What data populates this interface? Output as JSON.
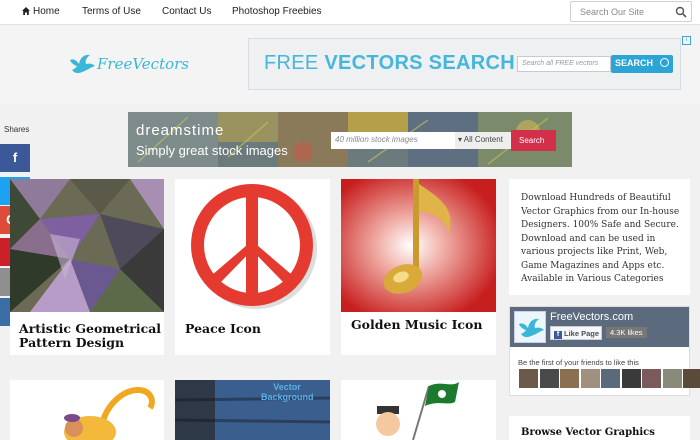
{
  "nav": {
    "home": "Home",
    "terms": "Terms of Use",
    "contact": "Contact Us",
    "freebies": "Photoshop Freebies",
    "search_placeholder": "Search Our Site"
  },
  "logo": {
    "text": "FreeVectors"
  },
  "ad_top": {
    "title_light": "FREE ",
    "title_bold": "VECTORS SEARCH",
    "input_placeholder": "Search all FREE vectors",
    "button": "SEARCH",
    "adchoice": "i"
  },
  "ad_dreamstime": {
    "brand": "dreamstime",
    "tagline": "Simply great stock images",
    "input_placeholder": "40 million stock images",
    "select": "All Content",
    "button": "Search"
  },
  "shares": {
    "label": "Shares",
    "buttons": [
      {
        "icon": "facebook-icon",
        "glyph": "f",
        "color": "#3b5998"
      },
      {
        "icon": "twitter-icon",
        "glyph": "t",
        "color": "#1da1f2"
      },
      {
        "icon": "google-plus-icon",
        "glyph": "G+",
        "color": "#dd4b39"
      },
      {
        "icon": "pinterest-icon",
        "glyph": "P",
        "color": "#cb2027"
      },
      {
        "icon": "email-icon",
        "glyph": "✉",
        "color": "#8f8f8f"
      },
      {
        "icon": "buffer-icon",
        "glyph": "≡",
        "color": "#3a6ea5"
      }
    ]
  },
  "cards": [
    {
      "title": "Artistic Geometrical Pattern Design"
    },
    {
      "title": "Peace Icon"
    },
    {
      "title": "Golden Music Icon"
    }
  ],
  "bottom_cards": [
    {
      "label": ""
    },
    {
      "label": "Vector Background"
    },
    {
      "label": ""
    }
  ],
  "sidebar": {
    "description": "Download Hundreds of Beautiful Vector Graphics from our In-house Designers. 100% Safe and Secure. Download and can be used in various projects like Print, Web, Game Magazines and Apps etc. Available in Various Categories",
    "facebook": {
      "page_name": "FreeVectors.com",
      "like_button": "Like Page",
      "likes": "4.3K likes",
      "friends_text": "Be the first of your friends to like this"
    },
    "browse_title": "Browse Vector Graphics"
  },
  "colors": {
    "accent": "#3ab7d8",
    "search_button": "#2aa5d6",
    "dreamstime_button": "#d12f4a"
  }
}
